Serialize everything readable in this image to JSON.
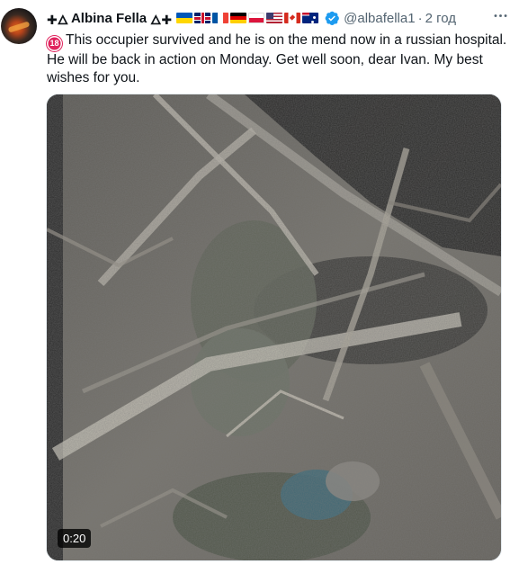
{
  "author": {
    "prefix_symbols": "✚🜂",
    "name": "Albina Fella",
    "mid_symbols": "🜂✚",
    "flags": [
      "flag-ukraine",
      "flag-uk",
      "flag-france",
      "flag-germany",
      "flag-poland",
      "flag-usa",
      "flag-canada",
      "flag-australia"
    ],
    "verified_icon": "verified-badge-icon",
    "handle": "@albafella1",
    "separator": "·",
    "time": "2 год"
  },
  "tweet": {
    "badge": "18",
    "text": "This occupier survived and he is on the mend now in a russian hospital. He will be back in action on Monday. Get well soon, dear Ivan. My best wishes for you."
  },
  "media": {
    "duration": "0:20"
  },
  "colors": {
    "verified": "#1d9bf0",
    "badge": "#e0245e",
    "secondary_text": "#536471"
  }
}
